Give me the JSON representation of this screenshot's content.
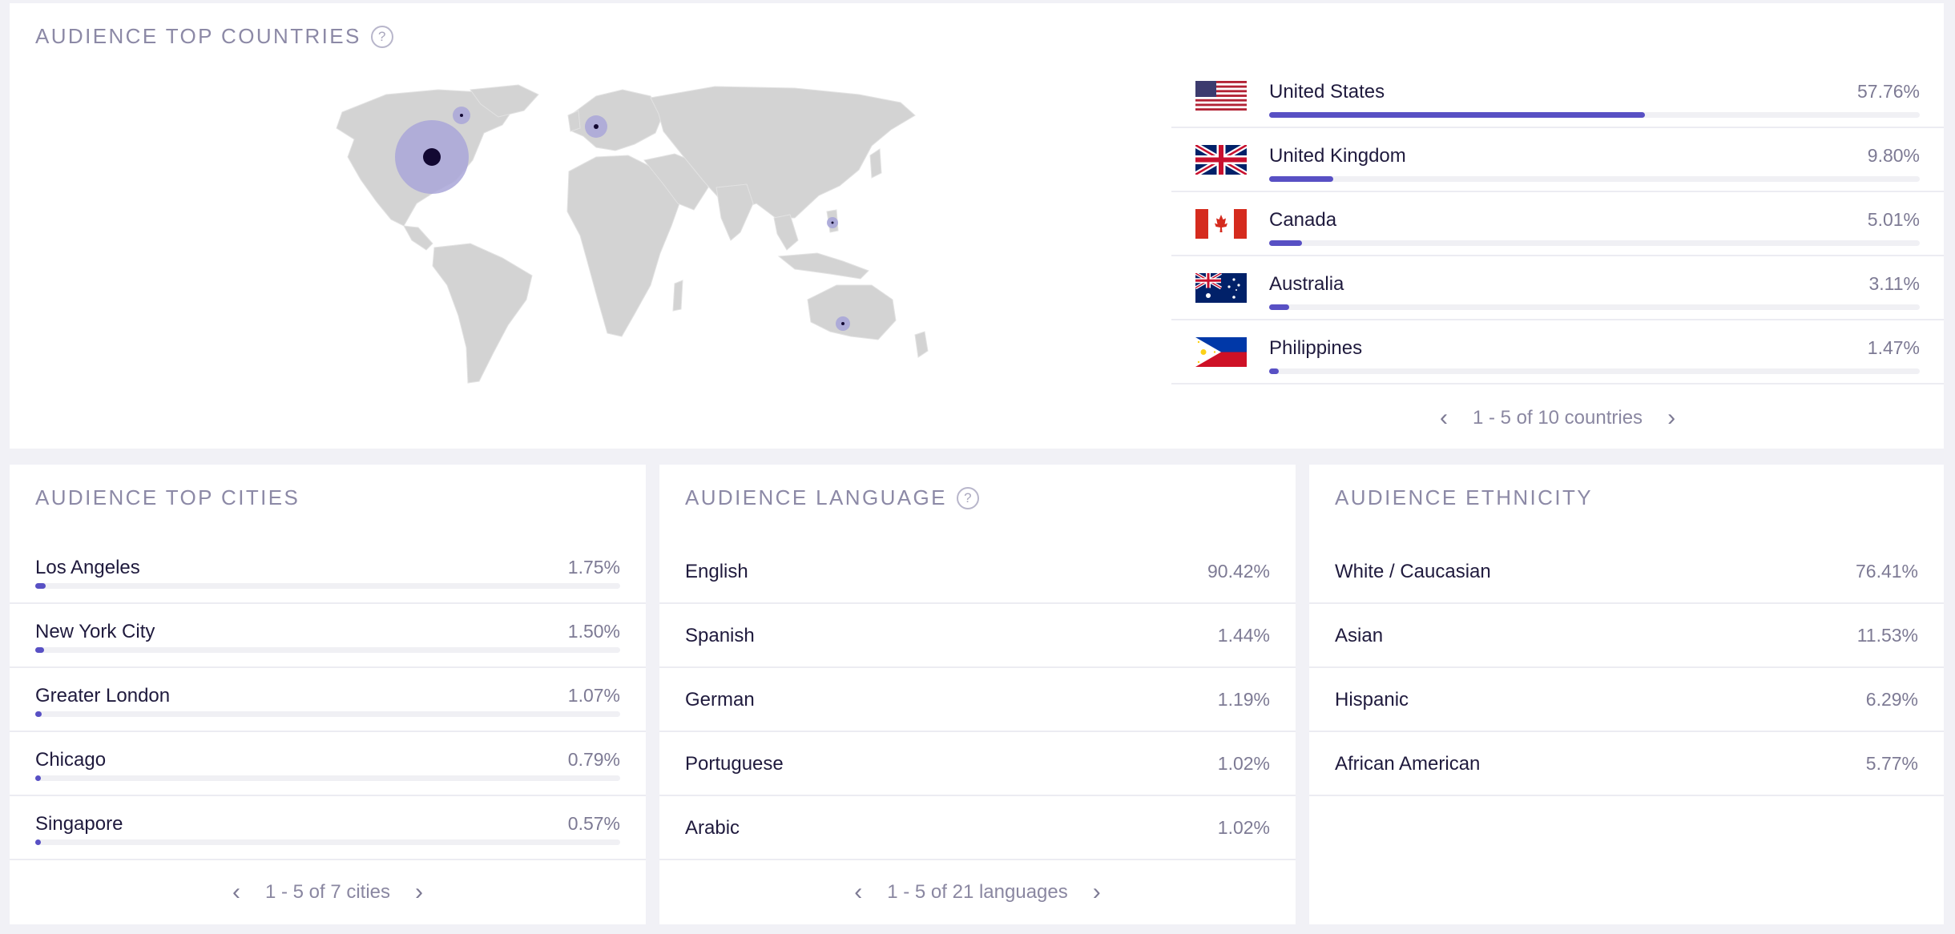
{
  "colors": {
    "accent": "#5850c4",
    "bubble": "#a9a6d8",
    "map_land": "#d2d2d2"
  },
  "top_countries": {
    "title": "AUDIENCE TOP COUNTRIES",
    "help_icon": "question-circle-icon",
    "rows": [
      {
        "flag": "us-flag-icon",
        "name": "United States",
        "pct": "57.76%",
        "value": 57.76
      },
      {
        "flag": "uk-flag-icon",
        "name": "United Kingdom",
        "pct": "9.80%",
        "value": 9.8
      },
      {
        "flag": "canada-flag-icon",
        "name": "Canada",
        "pct": "5.01%",
        "value": 5.01
      },
      {
        "flag": "australia-flag-icon",
        "name": "Australia",
        "pct": "3.11%",
        "value": 3.11
      },
      {
        "flag": "philippines-flag-icon",
        "name": "Philippines",
        "pct": "1.47%",
        "value": 1.47
      }
    ],
    "pager": {
      "text": "1 - 5 of 10 countries",
      "prev": "‹",
      "next": "›"
    }
  },
  "top_cities": {
    "title": "AUDIENCE TOP CITIES",
    "rows": [
      {
        "name": "Los Angeles",
        "pct": "1.75%",
        "value": 1.75
      },
      {
        "name": "New York City",
        "pct": "1.50%",
        "value": 1.5
      },
      {
        "name": "Greater London",
        "pct": "1.07%",
        "value": 1.07
      },
      {
        "name": "Chicago",
        "pct": "0.79%",
        "value": 0.79
      },
      {
        "name": "Singapore",
        "pct": "0.57%",
        "value": 0.57
      }
    ],
    "pager": {
      "text": "1 - 5 of 7 cities",
      "prev": "‹",
      "next": "›"
    }
  },
  "language": {
    "title": "AUDIENCE LANGUAGE",
    "help_icon": "question-circle-icon",
    "rows": [
      {
        "name": "English",
        "pct": "90.42%"
      },
      {
        "name": "Spanish",
        "pct": "1.44%"
      },
      {
        "name": "German",
        "pct": "1.19%"
      },
      {
        "name": "Portuguese",
        "pct": "1.02%"
      },
      {
        "name": "Arabic",
        "pct": "1.02%"
      }
    ],
    "pager": {
      "text": "1 - 5 of 21 languages",
      "prev": "‹",
      "next": "›"
    }
  },
  "ethnicity": {
    "title": "AUDIENCE ETHNICITY",
    "rows": [
      {
        "name": "White / Caucasian",
        "pct": "76.41%"
      },
      {
        "name": "Asian",
        "pct": "11.53%"
      },
      {
        "name": "Hispanic",
        "pct": "6.29%"
      },
      {
        "name": "African American",
        "pct": "5.77%"
      }
    ]
  }
}
